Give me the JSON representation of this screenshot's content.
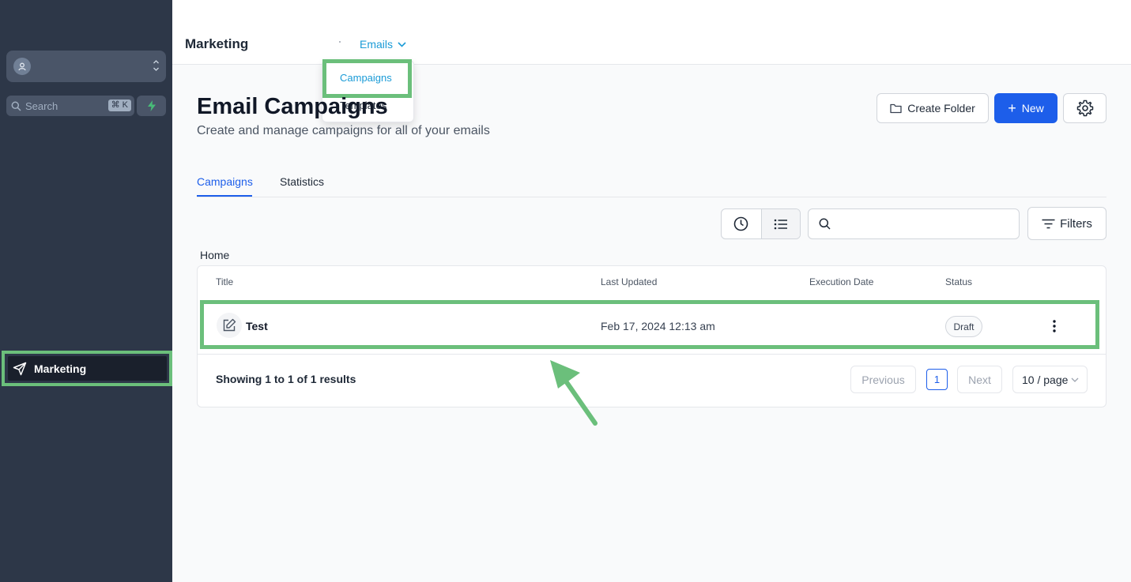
{
  "sidebar": {
    "search": {
      "placeholder": "Search",
      "shortcut": "⌘ K"
    },
    "nav": {
      "marketing_label": "Marketing"
    }
  },
  "topbar": {
    "app_title": "Marketing",
    "menu_label": "Emails"
  },
  "dropdown": {
    "items": [
      {
        "label": "Campaigns",
        "active": true
      },
      {
        "label": "Templates",
        "active": false
      }
    ]
  },
  "page": {
    "title": "Email Campaigns",
    "subtitle": "Create and manage campaigns for all of your emails"
  },
  "actions": {
    "create_folder_label": "Create Folder",
    "new_label": "New",
    "filters_label": "Filters"
  },
  "tabs": [
    {
      "label": "Campaigns",
      "active": true
    },
    {
      "label": "Statistics",
      "active": false
    }
  ],
  "breadcrumb": "Home",
  "table": {
    "columns": [
      "Title",
      "Last Updated",
      "Execution Date",
      "Status"
    ],
    "rows": [
      {
        "title": "Test",
        "last_updated": "Feb 17, 2024 12:13 am",
        "execution_date": "",
        "status": "Draft"
      }
    ]
  },
  "pagination": {
    "summary": "Showing 1 to 1 of 1 results",
    "previous_label": "Previous",
    "current_page": "1",
    "next_label": "Next",
    "page_size": "10 / page"
  },
  "colors": {
    "sidebar_bg": "#2d3748",
    "primary": "#1d5eea",
    "link": "#1a9bd7",
    "highlight": "#6bbf7b"
  },
  "icons": [
    "user-icon",
    "updown-icon",
    "search-icon",
    "bolt-icon",
    "send-icon",
    "chevron-down-icon",
    "folder-icon",
    "plus-icon",
    "gear-icon",
    "clock-icon",
    "list-icon",
    "filter-icon",
    "edit-icon",
    "kebab-icon",
    "arrow-annotation"
  ]
}
